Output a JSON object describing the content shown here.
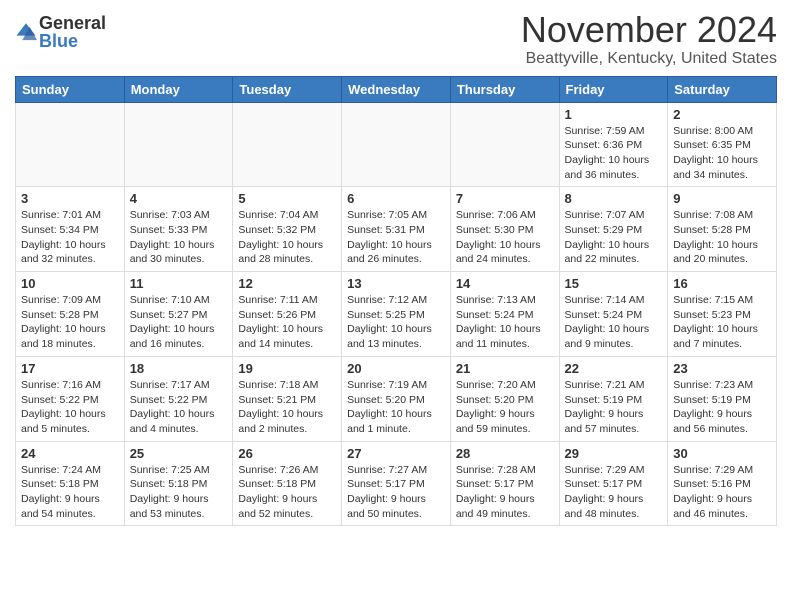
{
  "header": {
    "logo_general": "General",
    "logo_blue": "Blue",
    "month_title": "November 2024",
    "location": "Beattyville, Kentucky, United States"
  },
  "days_of_week": [
    "Sunday",
    "Monday",
    "Tuesday",
    "Wednesday",
    "Thursday",
    "Friday",
    "Saturday"
  ],
  "weeks": [
    [
      {
        "day": "",
        "info": ""
      },
      {
        "day": "",
        "info": ""
      },
      {
        "day": "",
        "info": ""
      },
      {
        "day": "",
        "info": ""
      },
      {
        "day": "",
        "info": ""
      },
      {
        "day": "1",
        "info": "Sunrise: 7:59 AM\nSunset: 6:36 PM\nDaylight: 10 hours\nand 36 minutes."
      },
      {
        "day": "2",
        "info": "Sunrise: 8:00 AM\nSunset: 6:35 PM\nDaylight: 10 hours\nand 34 minutes."
      }
    ],
    [
      {
        "day": "3",
        "info": "Sunrise: 7:01 AM\nSunset: 5:34 PM\nDaylight: 10 hours\nand 32 minutes."
      },
      {
        "day": "4",
        "info": "Sunrise: 7:03 AM\nSunset: 5:33 PM\nDaylight: 10 hours\nand 30 minutes."
      },
      {
        "day": "5",
        "info": "Sunrise: 7:04 AM\nSunset: 5:32 PM\nDaylight: 10 hours\nand 28 minutes."
      },
      {
        "day": "6",
        "info": "Sunrise: 7:05 AM\nSunset: 5:31 PM\nDaylight: 10 hours\nand 26 minutes."
      },
      {
        "day": "7",
        "info": "Sunrise: 7:06 AM\nSunset: 5:30 PM\nDaylight: 10 hours\nand 24 minutes."
      },
      {
        "day": "8",
        "info": "Sunrise: 7:07 AM\nSunset: 5:29 PM\nDaylight: 10 hours\nand 22 minutes."
      },
      {
        "day": "9",
        "info": "Sunrise: 7:08 AM\nSunset: 5:28 PM\nDaylight: 10 hours\nand 20 minutes."
      }
    ],
    [
      {
        "day": "10",
        "info": "Sunrise: 7:09 AM\nSunset: 5:28 PM\nDaylight: 10 hours\nand 18 minutes."
      },
      {
        "day": "11",
        "info": "Sunrise: 7:10 AM\nSunset: 5:27 PM\nDaylight: 10 hours\nand 16 minutes."
      },
      {
        "day": "12",
        "info": "Sunrise: 7:11 AM\nSunset: 5:26 PM\nDaylight: 10 hours\nand 14 minutes."
      },
      {
        "day": "13",
        "info": "Sunrise: 7:12 AM\nSunset: 5:25 PM\nDaylight: 10 hours\nand 13 minutes."
      },
      {
        "day": "14",
        "info": "Sunrise: 7:13 AM\nSunset: 5:24 PM\nDaylight: 10 hours\nand 11 minutes."
      },
      {
        "day": "15",
        "info": "Sunrise: 7:14 AM\nSunset: 5:24 PM\nDaylight: 10 hours\nand 9 minutes."
      },
      {
        "day": "16",
        "info": "Sunrise: 7:15 AM\nSunset: 5:23 PM\nDaylight: 10 hours\nand 7 minutes."
      }
    ],
    [
      {
        "day": "17",
        "info": "Sunrise: 7:16 AM\nSunset: 5:22 PM\nDaylight: 10 hours\nand 5 minutes."
      },
      {
        "day": "18",
        "info": "Sunrise: 7:17 AM\nSunset: 5:22 PM\nDaylight: 10 hours\nand 4 minutes."
      },
      {
        "day": "19",
        "info": "Sunrise: 7:18 AM\nSunset: 5:21 PM\nDaylight: 10 hours\nand 2 minutes."
      },
      {
        "day": "20",
        "info": "Sunrise: 7:19 AM\nSunset: 5:20 PM\nDaylight: 10 hours\nand 1 minute."
      },
      {
        "day": "21",
        "info": "Sunrise: 7:20 AM\nSunset: 5:20 PM\nDaylight: 9 hours\nand 59 minutes."
      },
      {
        "day": "22",
        "info": "Sunrise: 7:21 AM\nSunset: 5:19 PM\nDaylight: 9 hours\nand 57 minutes."
      },
      {
        "day": "23",
        "info": "Sunrise: 7:23 AM\nSunset: 5:19 PM\nDaylight: 9 hours\nand 56 minutes."
      }
    ],
    [
      {
        "day": "24",
        "info": "Sunrise: 7:24 AM\nSunset: 5:18 PM\nDaylight: 9 hours\nand 54 minutes."
      },
      {
        "day": "25",
        "info": "Sunrise: 7:25 AM\nSunset: 5:18 PM\nDaylight: 9 hours\nand 53 minutes."
      },
      {
        "day": "26",
        "info": "Sunrise: 7:26 AM\nSunset: 5:18 PM\nDaylight: 9 hours\nand 52 minutes."
      },
      {
        "day": "27",
        "info": "Sunrise: 7:27 AM\nSunset: 5:17 PM\nDaylight: 9 hours\nand 50 minutes."
      },
      {
        "day": "28",
        "info": "Sunrise: 7:28 AM\nSunset: 5:17 PM\nDaylight: 9 hours\nand 49 minutes."
      },
      {
        "day": "29",
        "info": "Sunrise: 7:29 AM\nSunset: 5:17 PM\nDaylight: 9 hours\nand 48 minutes."
      },
      {
        "day": "30",
        "info": "Sunrise: 7:29 AM\nSunset: 5:16 PM\nDaylight: 9 hours\nand 46 minutes."
      }
    ]
  ]
}
